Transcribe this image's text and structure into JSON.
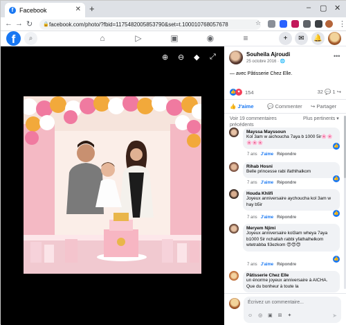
{
  "browser": {
    "tab_title": "Facebook",
    "tab_favicon": "f",
    "new_tab": "+",
    "url": "facebook.com/photo/?fbid=1175482005853790&set=t.100010768057678"
  },
  "fb_header": {
    "logo": "f"
  },
  "viewer": {
    "icons": [
      "zoom-in-icon",
      "zoom-out-icon",
      "tag-icon",
      "fullscreen-icon"
    ]
  },
  "post": {
    "author": "Souheila Ajroudi",
    "date": "25 octobre 2016 · ",
    "caption": "— avec Pâtisserie Chez Elle.",
    "reaction_count": "154",
    "comment_count": "32",
    "share_count": "1",
    "like_label": "J'aime",
    "comment_label": "Commenter",
    "share_label": "Partager",
    "view_previous": "Voir 19 commentaires précédents",
    "sort_label": "Plus pertinents ▾"
  },
  "comments": [
    {
      "name": "Mayssa Mayssoun",
      "text": "Kol 3am w aichoucha 7aya b 1000 5ir🌸🌸🌸🌸🌸",
      "time": "7 ans",
      "like": "J'aime",
      "reply": "Répondre",
      "liked": true
    },
    {
      "name": "Rihab Hosni",
      "text": "Belle princesse rabi ifathlhalkom",
      "time": "7 ans",
      "like": "J'aime",
      "reply": "Répondre",
      "liked": true
    },
    {
      "name": "Houda Khlifi",
      "text": "Joyeux anniversaire aychoucha kol 3am w hay b5ir",
      "time": "7 ans",
      "like": "J'aime",
      "reply": "Répondre",
      "liked": true
    },
    {
      "name": "Meryem Njimi",
      "text": "Joyeux anniversaire kol3am wheya 7aya b1000 5ir nchallah rabbi yfathalhelkom wtetrabba fi3ezkom 😍😍😍",
      "time": "7 ans",
      "like": "J'aime",
      "reply": "Répondre",
      "liked": true
    },
    {
      "name": "Pâtisserie Chez Elle",
      "text": "un énorme joyeux anniversaire à AICHA. Que du bonheur à toute la",
      "time": "",
      "like": "",
      "reply": "",
      "liked": false
    }
  ],
  "composer": {
    "placeholder": "Écrivez un commentaire...",
    "icons": "☺ ◎ ▣ ⊞ ✦",
    "send": "➤"
  },
  "colors": {
    "facebook_blue": "#1877f2",
    "viewer_bg": "#000000",
    "bubble_bg": "#f0f2f5"
  }
}
